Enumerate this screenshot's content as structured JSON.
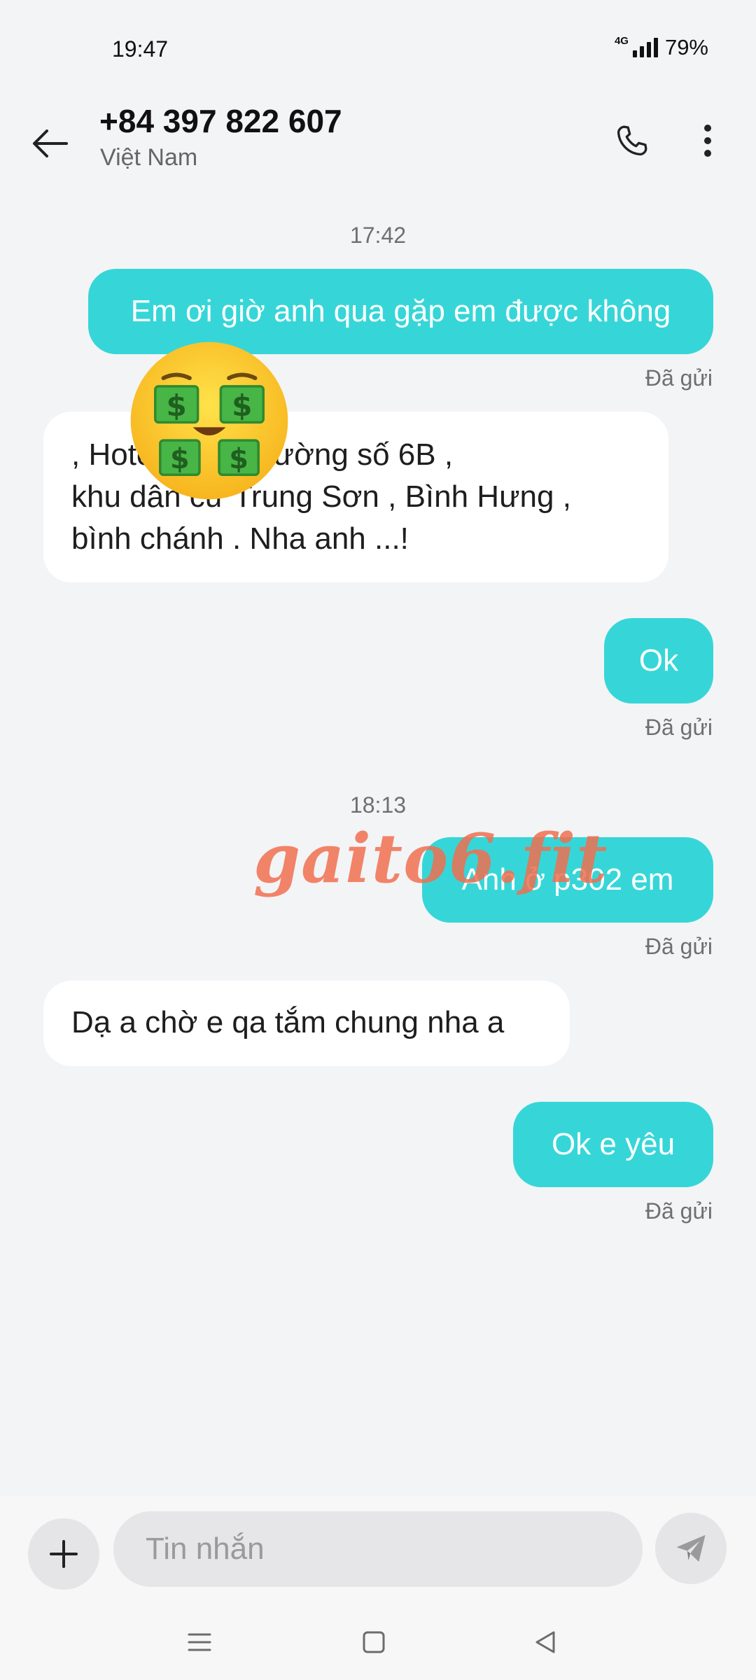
{
  "status_bar": {
    "time": "19:47",
    "network": "4G",
    "battery": "79%"
  },
  "header": {
    "name": "+84 397 822 607",
    "subtitle": "Việt Nam"
  },
  "messages": [
    {
      "timestamp": "17:42"
    },
    {
      "type": "sent",
      "text": "Em ơi giờ anh qua gặp em được không",
      "status": "Đã gửi"
    },
    {
      "type": "received",
      "lines": [
        ", Hotel 27-29 đường số 6B ,",
        "khu dân cư Trung Sơn , Bình Hưng ,",
        "bình chánh . Nha anh ...!"
      ]
    },
    {
      "type": "sent",
      "text": "Ok",
      "status": "Đã gửi"
    },
    {
      "timestamp": "18:13"
    },
    {
      "type": "sent",
      "text": "Anh ở p302 em",
      "status": "Đã gửi"
    },
    {
      "type": "received",
      "lines": [
        "Dạ a chờ e qa tắm chung nha a"
      ]
    },
    {
      "type": "sent",
      "text": "Ok e yêu",
      "status": "Đã gửi"
    }
  ],
  "overlay": {
    "emoji": "money-mouth-face",
    "watermark": "gaito6.fit"
  },
  "composer": {
    "placeholder": "Tin nhắn"
  },
  "colors": {
    "sent_bubble": "#36d6d8",
    "background": "#f3f4f6",
    "received_bubble": "#ffffff"
  }
}
